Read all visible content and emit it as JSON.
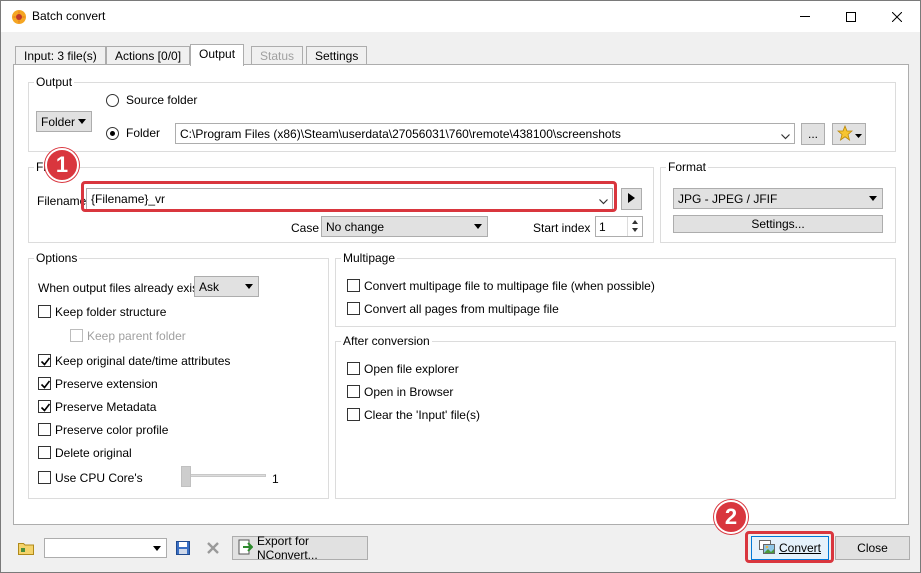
{
  "window": {
    "title": "Batch convert"
  },
  "tabs": [
    {
      "label": "Input: 3 file(s)",
      "state": "normal"
    },
    {
      "label": "Actions [0/0]",
      "state": "normal"
    },
    {
      "label": "Output",
      "state": "active"
    },
    {
      "label": "Status",
      "state": "disabled"
    },
    {
      "label": "Settings",
      "state": "normal"
    }
  ],
  "output": {
    "group_label": "Output",
    "destination_type": "Folder",
    "source_folder_label": "Source folder",
    "folder_label": "Folder",
    "folder_path": "C:\\Program Files (x86)\\Steam\\userdata\\27056031\\760\\remote\\438100\\screenshots",
    "browse_label": "...",
    "selected_radio": "Folder"
  },
  "file": {
    "group_label": "File",
    "filename_label": "Filename",
    "filename_value": "{Filename}_vr",
    "case_label": "Case",
    "case_value": "No change",
    "start_index_label": "Start index",
    "start_index_value": "1"
  },
  "format": {
    "group_label": "Format",
    "value": "JPG - JPEG / JFIF",
    "settings_label": "Settings..."
  },
  "options": {
    "group_label": "Options",
    "when_exist_label": "When output files already exist",
    "when_exist_value": "Ask",
    "keep_folder_structure": {
      "label": "Keep folder structure",
      "checked": false
    },
    "keep_parent_folder": {
      "label": "Keep parent folder",
      "checked": false
    },
    "keep_original_date": {
      "label": "Keep original date/time attributes",
      "checked": true
    },
    "preserve_extension": {
      "label": "Preserve extension",
      "checked": true
    },
    "preserve_metadata": {
      "label": "Preserve Metadata",
      "checked": true
    },
    "preserve_color_profile": {
      "label": "Preserve color profile",
      "checked": false
    },
    "delete_original": {
      "label": "Delete original",
      "checked": false
    },
    "use_cpu_cores": {
      "label": "Use CPU Core's",
      "checked": false
    },
    "cpu_cores_value": "1"
  },
  "multipage": {
    "group_label": "Multipage",
    "convert_multipage": {
      "label": "Convert multipage file to multipage file (when possible)",
      "checked": false
    },
    "convert_all_pages": {
      "label": "Convert all pages from multipage file",
      "checked": false
    }
  },
  "after_conversion": {
    "group_label": "After conversion",
    "open_explorer": {
      "label": "Open file explorer",
      "checked": false
    },
    "open_browser": {
      "label": "Open in Browser",
      "checked": false
    },
    "clear_input": {
      "label": "Clear the 'Input' file(s)",
      "checked": false
    }
  },
  "bottom": {
    "preset_value": "",
    "export_label": "Export for NConvert...",
    "convert_label": "Convert",
    "close_label": "Close"
  },
  "annotations": {
    "marker1": "1",
    "marker2": "2",
    "accent_color": "#d9363e"
  }
}
